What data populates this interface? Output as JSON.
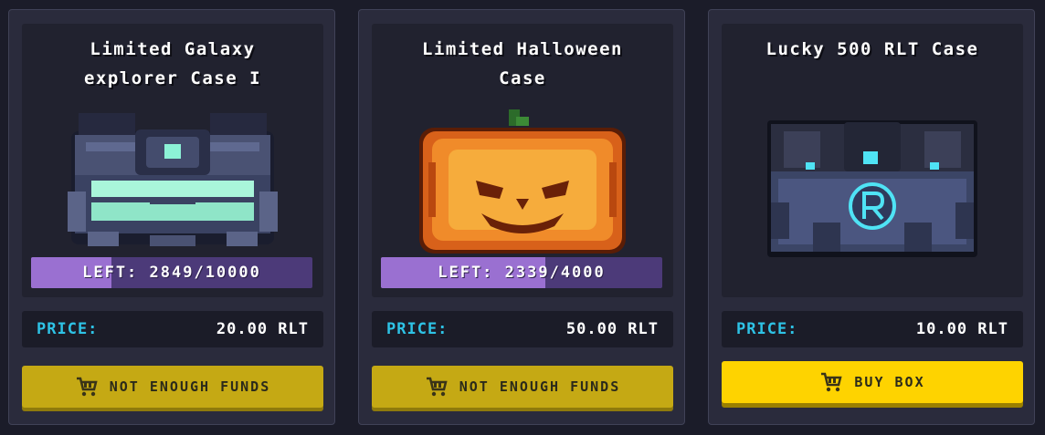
{
  "cards": [
    {
      "title_line1": "Limited Galaxy",
      "title_line2": "explorer Case I",
      "left_text": "LEFT: 2849/10000",
      "left_progress": 0.2849,
      "price_label": "PRICE:",
      "price_value": "20.00 RLT",
      "button_label": "NOT ENOUGH FUNDS",
      "button_icon": "cart-icon",
      "chest_icon": "galaxy-chest-icon"
    },
    {
      "title_line1": "Limited Halloween",
      "title_line2": "Case",
      "left_text": "LEFT: 2339/4000",
      "left_progress": 0.58475,
      "price_label": "PRICE:",
      "price_value": "50.00 RLT",
      "button_label": "NOT ENOUGH FUNDS",
      "button_icon": "cart-icon",
      "chest_icon": "pumpkin-chest-icon"
    },
    {
      "title_line1": "Lucky 500 RLT Case",
      "title_line2": "",
      "price_label": "PRICE:",
      "price_value": "10.00 RLT",
      "button_label": "BUY BOX",
      "button_icon": "cart-icon",
      "chest_icon": "rlt-chest-icon"
    }
  ],
  "colors": {
    "background": "#1b1c29",
    "card": "#2a2b3c",
    "price_label": "#2ec3e6",
    "progress_fill": "#9a70d1",
    "button_disabled": "#c5a914",
    "button_active": "#fed300"
  }
}
